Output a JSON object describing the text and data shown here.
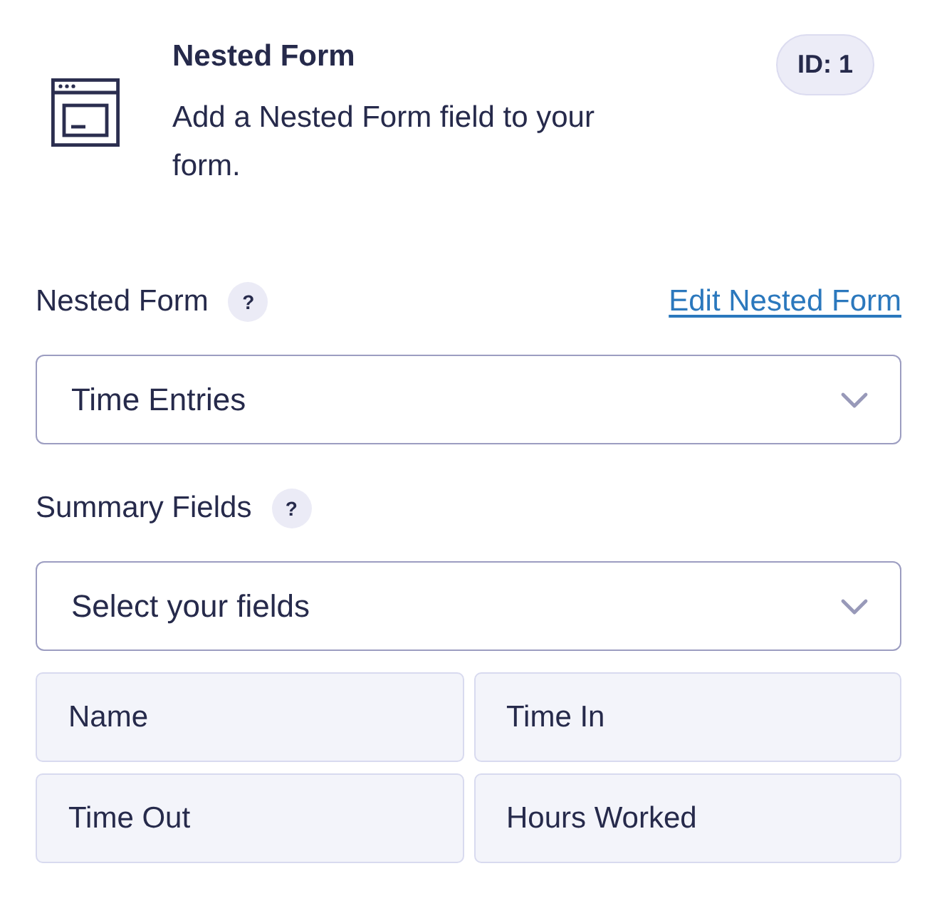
{
  "header": {
    "title": "Nested Form",
    "description": "Add a Nested Form field to your form.",
    "id_badge": "ID: 1"
  },
  "settings": [
    {
      "kind": "select",
      "label": "Nested Form",
      "help": "?",
      "link": "Edit Nested Form",
      "value": "Time Entries"
    },
    {
      "kind": "multiselect",
      "label": "Summary Fields",
      "help": "?",
      "placeholder": "Select your fields",
      "chips": [
        "Name",
        "Time In",
        "Time Out",
        "Hours Worked"
      ]
    }
  ]
}
